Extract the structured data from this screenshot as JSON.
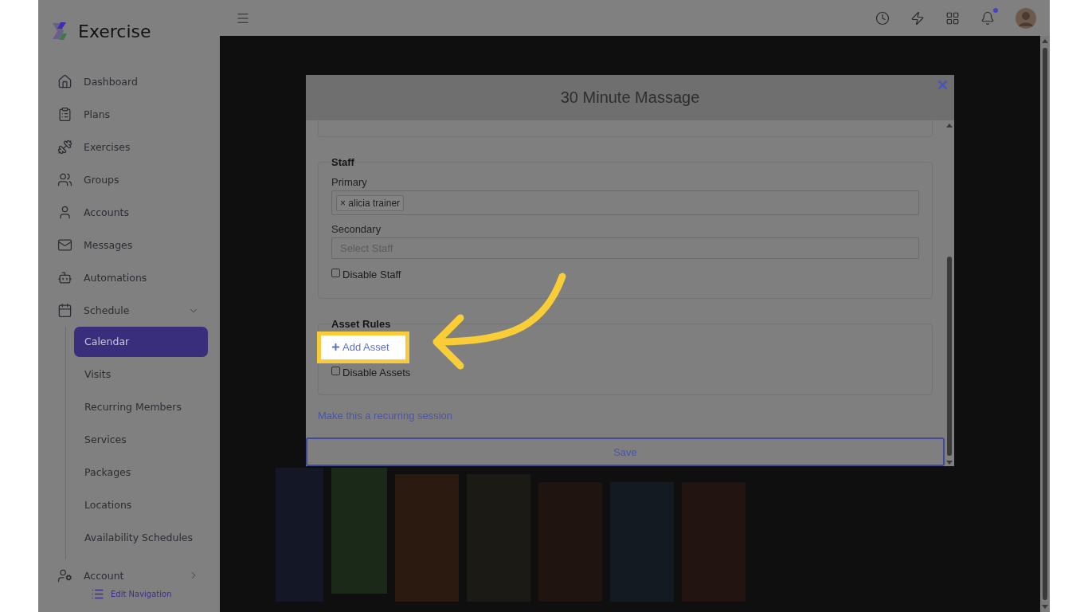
{
  "brand": {
    "name": "Exercise"
  },
  "sidebar": {
    "items": [
      {
        "label": "Dashboard",
        "selected": false
      },
      {
        "label": "Plans",
        "selected": false
      },
      {
        "label": "Exercises",
        "selected": false
      },
      {
        "label": "Groups",
        "selected": false
      },
      {
        "label": "Accounts",
        "selected": false
      },
      {
        "label": "Messages",
        "selected": false
      },
      {
        "label": "Automations",
        "selected": false
      },
      {
        "label": "Schedule",
        "selected": false,
        "expanded": true,
        "children": [
          {
            "label": "Calendar",
            "selected": true
          },
          {
            "label": "Visits",
            "selected": false
          },
          {
            "label": "Recurring Members",
            "selected": false
          },
          {
            "label": "Services",
            "selected": false
          },
          {
            "label": "Packages",
            "selected": false
          },
          {
            "label": "Locations",
            "selected": false
          },
          {
            "label": "Availability Schedules",
            "selected": false
          }
        ]
      },
      {
        "label": "Account",
        "selected": false,
        "expanded": false
      }
    ],
    "edit_link": "Edit Navigation"
  },
  "topbar": {
    "notifications_unread": true
  },
  "modal": {
    "title": "30 Minute Massage",
    "staff": {
      "legend": "Staff",
      "primary_label": "Primary",
      "primary_tags": [
        {
          "remove": "×",
          "label": "alicia trainer"
        }
      ],
      "secondary_label": "Secondary",
      "secondary_placeholder": "Select Staff",
      "disable": {
        "label": "Disable Staff",
        "checked": false
      }
    },
    "assets": {
      "legend": "Asset Rules",
      "add_button": {
        "label": "Add Asset",
        "highlighted": true
      },
      "disable": {
        "label": "Disable Assets",
        "checked": false
      }
    },
    "recurring_link": "Make this a recurring session",
    "save": "Save"
  }
}
